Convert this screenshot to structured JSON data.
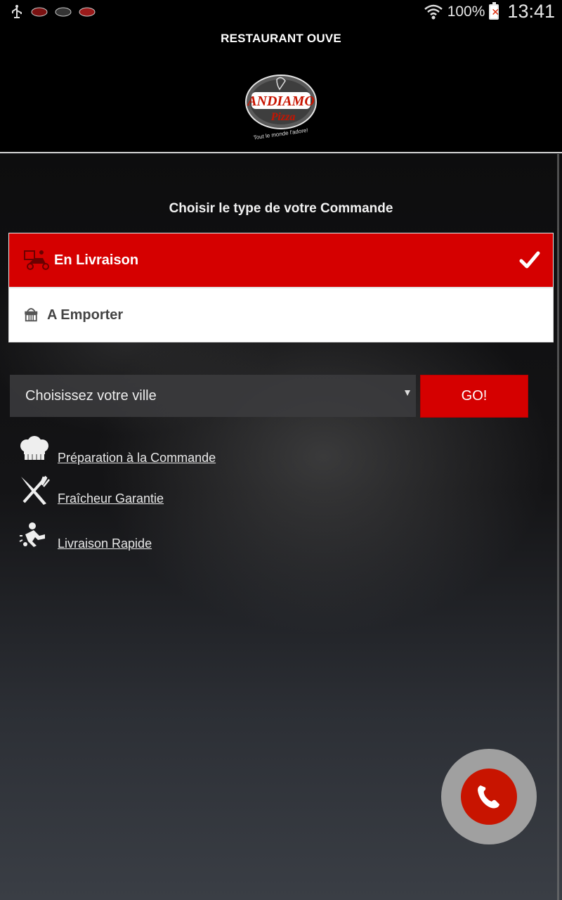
{
  "status_bar": {
    "battery_text": "100%",
    "clock": "13:41",
    "icons": [
      "usb-icon",
      "app-notification-icon",
      "app-notification-icon",
      "app-notification-icon",
      "wifi-icon",
      "battery-icon"
    ]
  },
  "header": {
    "title": "RESTAURANT OUVE",
    "logo_text_main": "ANDIAMO",
    "logo_text_sub": "Pizza",
    "logo_tagline": "Tout le monde l'adore!"
  },
  "order_type": {
    "title": "Choisir le type de votre Commande",
    "options": [
      {
        "label": "En Livraison",
        "icon": "delivery-scooter-icon",
        "selected": true
      },
      {
        "label": "A Emporter",
        "icon": "basket-icon",
        "selected": false
      }
    ]
  },
  "city": {
    "placeholder": "Choisissez votre ville",
    "go_label": "GO!"
  },
  "features": [
    {
      "label": "Préparation à la Commande",
      "icon": "chef-hat-icon"
    },
    {
      "label": "Fraîcheur Garantie",
      "icon": "fork-knife-icon"
    },
    {
      "label": "Livraison Rapide",
      "icon": "delivery-runner-icon"
    }
  ],
  "colors": {
    "accent": "#d50000",
    "call_button": "#c81400"
  }
}
